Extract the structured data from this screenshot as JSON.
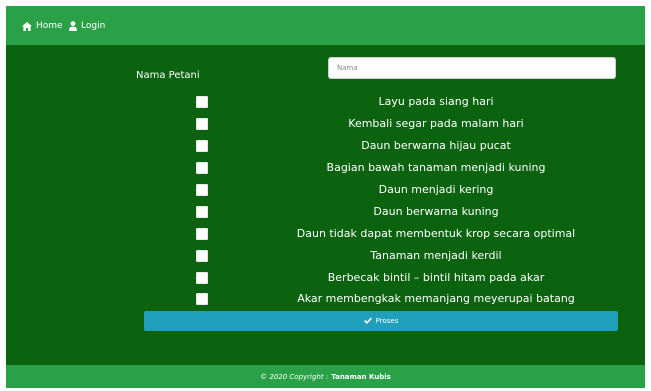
{
  "nav": {
    "home_label": "Home",
    "login_label": "Login"
  },
  "form": {
    "name_label": "Nama Petani",
    "name_placeholder": "Nama",
    "name_value": ""
  },
  "symptoms": [
    {
      "label": "Layu pada siang hari",
      "checked": false
    },
    {
      "label": "Kembali segar pada malam hari",
      "checked": false
    },
    {
      "label": "Daun berwarna hijau pucat",
      "checked": false
    },
    {
      "label": "Bagian bawah tanaman menjadi kuning",
      "checked": false
    },
    {
      "label": "Daun menjadi kering",
      "checked": false
    },
    {
      "label": "Daun berwarna kuning",
      "checked": false
    },
    {
      "label": "Daun tidak dapat membentuk krop secara optimal",
      "checked": false
    },
    {
      "label": "Tanaman menjadi kerdil",
      "checked": false
    },
    {
      "label": "Berbecak bintil – bintil hitam pada akar",
      "checked": false
    },
    {
      "label": "Akar membengkak memanjang meyerupai batang",
      "checked": false
    }
  ],
  "process_button": {
    "label": "Proses",
    "icon": "check-icon"
  },
  "footer": {
    "copyright": "© 2020 Copyright :",
    "brand": "Tanaman Kubis"
  },
  "colors": {
    "page_background": "#0b6310",
    "bar_background": "#2aa147",
    "button_background": "#1f9fba"
  }
}
